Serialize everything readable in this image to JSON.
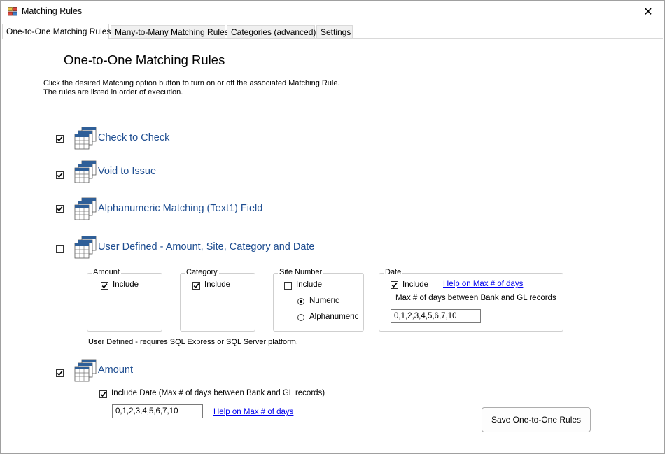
{
  "window": {
    "title": "Matching Rules",
    "close_glyph": "✕"
  },
  "tabs": [
    {
      "label": "One-to-One Matching Rules",
      "active": true
    },
    {
      "label": "Many-to-Many Matching Rules",
      "active": false
    },
    {
      "label": "Categories (advanced)",
      "active": false
    },
    {
      "label": "Settings",
      "active": false
    }
  ],
  "page": {
    "title": "One-to-One Matching Rules",
    "instructions_line1": "Click the desired Matching option button to turn on or off the associated Matching Rule.",
    "instructions_line2": "The rules are listed in order of execution."
  },
  "rules": [
    {
      "label": "Check to Check",
      "checked": true,
      "icon": "table-stack-icon"
    },
    {
      "label": "Void to Issue",
      "checked": true,
      "icon": "table-stack-icon"
    },
    {
      "label": "Alphanumeric Matching (Text1) Field",
      "checked": true,
      "icon": "table-stack-icon"
    },
    {
      "label": "User Defined - Amount, Site, Category and Date",
      "checked": false,
      "icon": "table-stack-icon"
    },
    {
      "label": "Amount",
      "checked": true,
      "icon": "table-stack-icon"
    }
  ],
  "user_defined": {
    "amount": {
      "title": "Amount",
      "include_label": "Include",
      "include_checked": true
    },
    "category": {
      "title": "Category",
      "include_label": "Include",
      "include_checked": true
    },
    "site_number": {
      "title": "Site Number",
      "include_label": "Include",
      "include_checked": false,
      "options": [
        {
          "label": "Numeric",
          "selected": true
        },
        {
          "label": "Alphanumeric",
          "selected": false
        }
      ]
    },
    "date": {
      "title": "Date",
      "include_label": "Include",
      "include_checked": true,
      "help_link": "Help on Max # of days",
      "max_days_label": "Max # of days between Bank and GL records",
      "max_days_value": "0,1,2,3,4,5,6,7,10"
    },
    "note": "User Defined - requires SQL Express or SQL Server platform."
  },
  "amount_rule": {
    "include_date_label": "Include Date (Max # of days between Bank and GL records)",
    "include_date_checked": true,
    "days_value": "0,1,2,3,4,5,6,7,10",
    "help_link": "Help on Max # of days"
  },
  "save_button": "Save One-to-One Rules",
  "colors": {
    "rule_label": "#1f4e91",
    "link": "#0000ee",
    "icon_blue": "#2f5f98"
  }
}
